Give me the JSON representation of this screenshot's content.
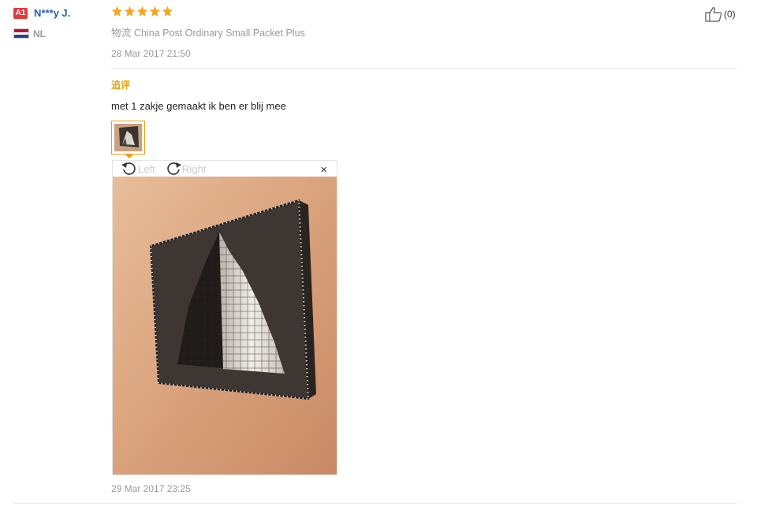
{
  "user": {
    "level": "A1",
    "name": "N***y J.",
    "country": "NL"
  },
  "review": {
    "rating": 5,
    "logistics_label": "物流",
    "logistics_value": "China Post Ordinary Small Packet Plus",
    "date": "28 Mar 2017 21:50",
    "helpful_count": "(0)"
  },
  "followup": {
    "title": "追评",
    "text": "met 1 zakje gemaakt ik ben er blij mee",
    "viewer": {
      "rotate_left": "Left",
      "rotate_right": "Right",
      "close": "×"
    },
    "date": "29 Mar 2017 23:25"
  },
  "colors": {
    "accent": "#e8a100",
    "star": "#f5a623",
    "username": "#2461a8",
    "badge": "#e4393c"
  }
}
